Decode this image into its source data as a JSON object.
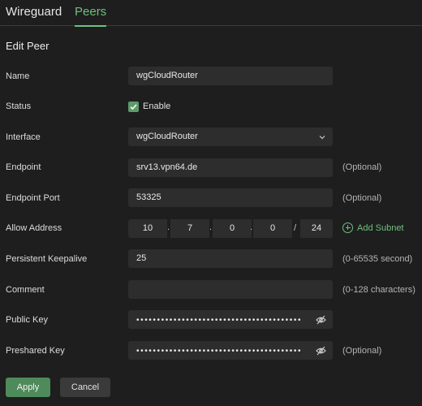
{
  "tabs": [
    {
      "label": "Wireguard",
      "active": false
    },
    {
      "label": "Peers",
      "active": true
    }
  ],
  "heading": "Edit Peer",
  "labels": {
    "name": "Name",
    "status": "Status",
    "interface": "Interface",
    "endpoint": "Endpoint",
    "endpoint_port": "Endpoint Port",
    "allow_address": "Allow Address",
    "persistent_keepalive": "Persistent Keepalive",
    "comment": "Comment",
    "public_key": "Public Key",
    "preshared_key": "Preshared Key"
  },
  "fields": {
    "name": "wgCloudRouter",
    "status_enabled": true,
    "status_label": "Enable",
    "interface": "wgCloudRouter",
    "endpoint": "srv13.vpn64.de",
    "endpoint_port": "53325",
    "allow_address": {
      "octets": [
        "10",
        "7",
        "0",
        "0"
      ],
      "separator": ".",
      "slash": "/",
      "prefix": "24"
    },
    "persistent_keepalive": "25",
    "comment": "",
    "public_key_mask": "••••••••••••••••••••••••••••••••••••••••",
    "preshared_key_mask": "••••••••••••••••••••••••••••••••••••••••"
  },
  "hints": {
    "endpoint": "(Optional)",
    "endpoint_port": "(Optional)",
    "persistent_keepalive": "(0-65535 second)",
    "comment": "(0-128 characters)",
    "preshared_key": "(Optional)"
  },
  "add_subnet": "Add Subnet",
  "buttons": {
    "apply": "Apply",
    "cancel": "Cancel"
  },
  "colors": {
    "accent": "#6fbf7e",
    "primary_button": "#4f8a5b",
    "background": "#1e1e1e",
    "field": "#2d2d2d"
  },
  "icons": {
    "chevron": "chevron-down-icon",
    "eye": "eye-off-icon",
    "plus": "plus-circle-icon",
    "check": "check-icon"
  }
}
